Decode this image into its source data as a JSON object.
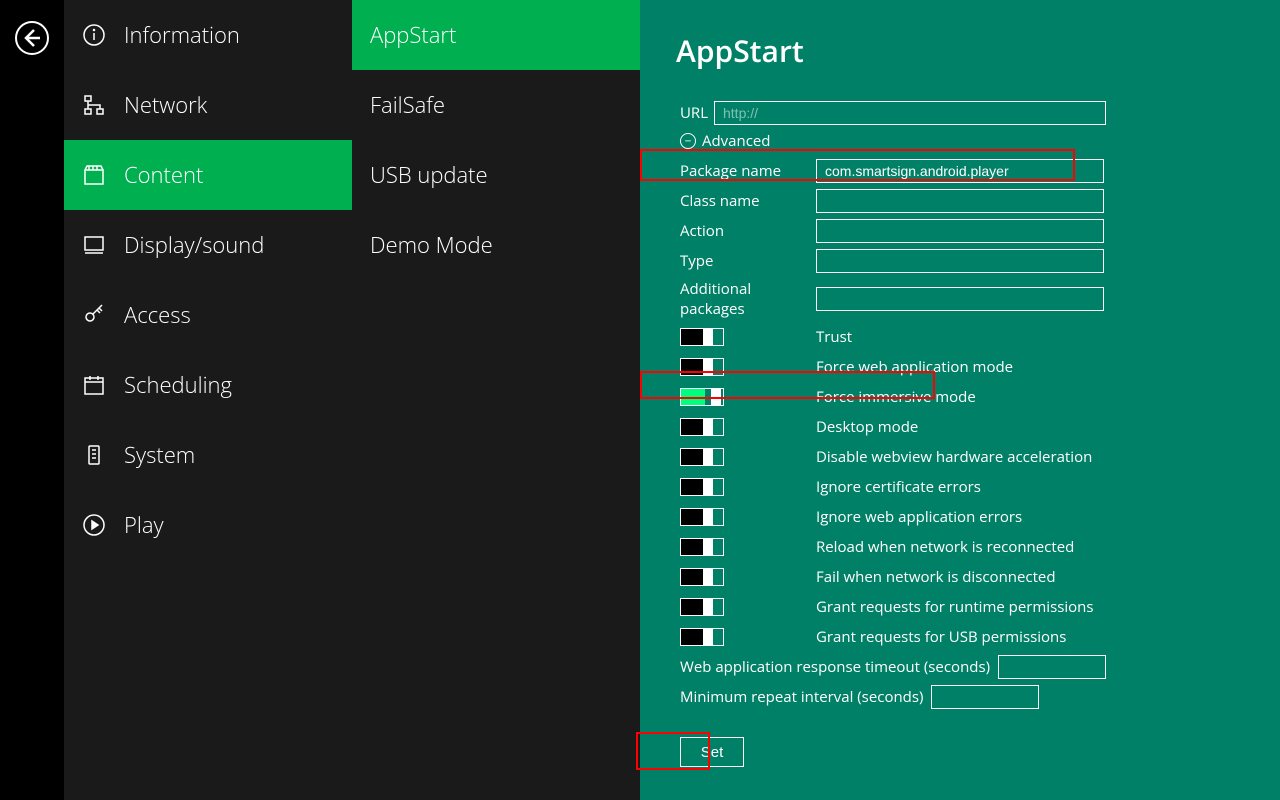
{
  "sidebar": {
    "items": [
      {
        "label": "Information",
        "icon": "information-icon"
      },
      {
        "label": "Network",
        "icon": "network-icon"
      },
      {
        "label": "Content",
        "icon": "content-icon"
      },
      {
        "label": "Display/sound",
        "icon": "display-icon"
      },
      {
        "label": "Access",
        "icon": "key-icon"
      },
      {
        "label": "Scheduling",
        "icon": "calendar-icon"
      },
      {
        "label": "System",
        "icon": "system-icon"
      },
      {
        "label": "Play",
        "icon": "play-icon"
      }
    ],
    "activeIndex": 2
  },
  "submenu": {
    "items": [
      {
        "label": "AppStart"
      },
      {
        "label": "FailSafe"
      },
      {
        "label": "USB update"
      },
      {
        "label": "Demo Mode"
      }
    ],
    "activeIndex": 0
  },
  "main": {
    "title": "AppStart",
    "url": {
      "label": "URL",
      "value": "",
      "placeholder": "http://"
    },
    "advanced_label": "Advanced",
    "fields": {
      "package_name": {
        "label": "Package name",
        "value": "com.smartsign.android.player"
      },
      "class_name": {
        "label": "Class name",
        "value": ""
      },
      "action": {
        "label": "Action",
        "value": ""
      },
      "type": {
        "label": "Type",
        "value": ""
      },
      "additional_packages": {
        "label": "Additional packages",
        "value": ""
      }
    },
    "toggles": [
      {
        "label": "Trust",
        "on": false
      },
      {
        "label": "Force web application mode",
        "on": false
      },
      {
        "label": "Force immersive mode",
        "on": true
      },
      {
        "label": "Desktop mode",
        "on": false
      },
      {
        "label": "Disable webview hardware acceleration",
        "on": false
      },
      {
        "label": "Ignore certificate errors",
        "on": false
      },
      {
        "label": "Ignore web application errors",
        "on": false
      },
      {
        "label": "Reload when network is reconnected",
        "on": false
      },
      {
        "label": "Fail when network is disconnected",
        "on": false
      },
      {
        "label": "Grant requests for runtime permissions",
        "on": false
      },
      {
        "label": "Grant requests for USB permissions",
        "on": false
      }
    ],
    "numeric": {
      "web_timeout": {
        "label": "Web application response timeout (seconds)",
        "value": ""
      },
      "min_repeat": {
        "label": "Minimum repeat interval (seconds)",
        "value": ""
      }
    },
    "set_label": "Set"
  }
}
